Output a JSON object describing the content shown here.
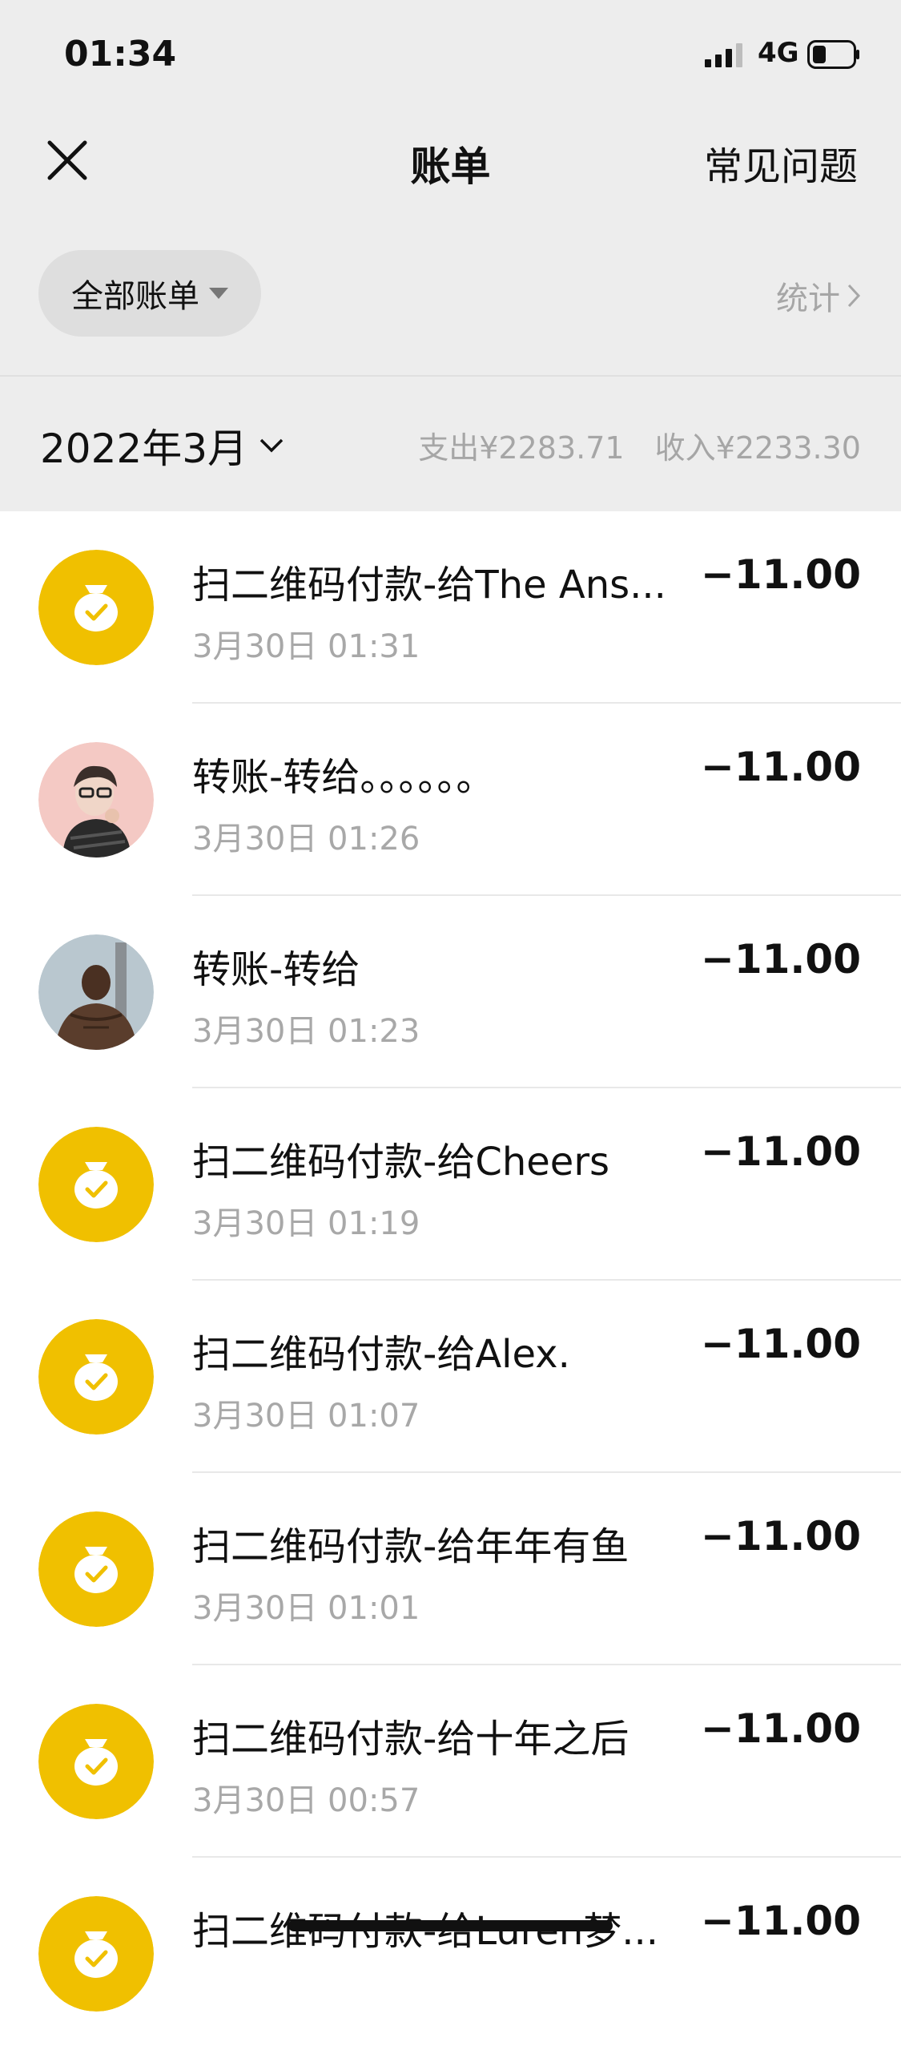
{
  "status_bar": {
    "time": "01:34",
    "network": "4G"
  },
  "nav": {
    "title": "账单",
    "faq": "常见问题"
  },
  "filter": {
    "label": "全部账单",
    "stats": "统计"
  },
  "month": {
    "label": "2022年3月",
    "expense": "支出¥2283.71",
    "income": "收入¥2233.30"
  },
  "transactions": [
    {
      "title": "扫二维码付款-给The Ans...",
      "time": "3月30日 01:31",
      "amount": "−11.00",
      "icon": "wallet-icon"
    },
    {
      "title": "转账-转给。。。。。。",
      "time": "3月30日 01:26",
      "amount": "−11.00",
      "icon": "user-avatar-1"
    },
    {
      "title": "转账-转给",
      "time": "3月30日 01:23",
      "amount": "−11.00",
      "icon": "user-avatar-2"
    },
    {
      "title": "扫二维码付款-给Cheers",
      "time": "3月30日 01:19",
      "amount": "−11.00",
      "icon": "wallet-icon"
    },
    {
      "title": "扫二维码付款-给Alex.",
      "time": "3月30日 01:07",
      "amount": "−11.00",
      "icon": "wallet-icon"
    },
    {
      "title": "扫二维码付款-给年年有鱼",
      "time": "3月30日 01:01",
      "amount": "−11.00",
      "icon": "wallet-icon"
    },
    {
      "title": "扫二维码付款-给十年之后",
      "time": "3月30日 00:57",
      "amount": "−11.00",
      "icon": "wallet-icon"
    },
    {
      "title": "扫二维码付款-给Luren梦...",
      "time": "",
      "amount": "−11.00",
      "icon": "wallet-icon"
    }
  ],
  "colors": {
    "accent": "#f0c000",
    "background_header": "#ededed",
    "muted_text": "#a6a6a6"
  }
}
